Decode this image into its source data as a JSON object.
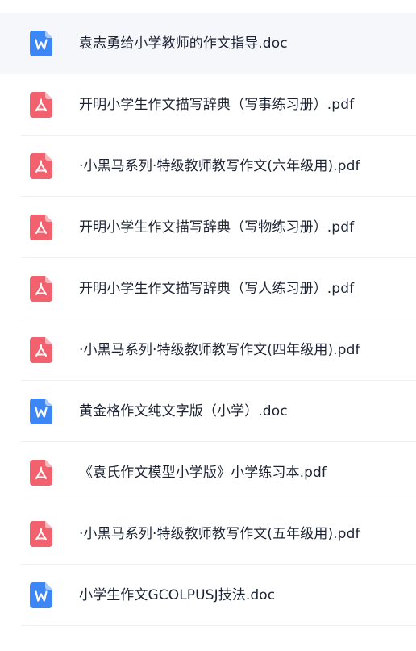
{
  "files": [
    {
      "name": "袁志勇给小学教师的作文指导.doc",
      "type": "doc",
      "icon": "word-doc-icon",
      "selected": true
    },
    {
      "name": "开明小学生作文描写辞典（写事练习册）.pdf",
      "type": "pdf",
      "icon": "pdf-icon",
      "selected": false
    },
    {
      "name": "·小黑马系列·特级教师教写作文(六年级用).pdf",
      "type": "pdf",
      "icon": "pdf-icon",
      "selected": false
    },
    {
      "name": "开明小学生作文描写辞典（写物练习册）.pdf",
      "type": "pdf",
      "icon": "pdf-icon",
      "selected": false
    },
    {
      "name": "开明小学生作文描写辞典（写人练习册）.pdf",
      "type": "pdf",
      "icon": "pdf-icon",
      "selected": false
    },
    {
      "name": "·小黑马系列·特级教师教写作文(四年级用).pdf",
      "type": "pdf",
      "icon": "pdf-icon",
      "selected": false
    },
    {
      "name": "黄金格作文纯文字版（小学）.doc",
      "type": "doc",
      "icon": "word-doc-icon",
      "selected": false
    },
    {
      "name": "《袁氏作文模型小学版》小学练习本.pdf",
      "type": "pdf",
      "icon": "pdf-icon",
      "selected": false
    },
    {
      "name": "·小黑马系列·特级教师教写作文(五年级用).pdf",
      "type": "pdf",
      "icon": "pdf-icon",
      "selected": false
    },
    {
      "name": "小学生作文GCOLPUSJ技法.doc",
      "type": "doc",
      "icon": "word-doc-icon",
      "selected": false
    }
  ],
  "colors": {
    "doc": "#3d86f5",
    "pdf": "#f2616e",
    "selected_background": "#f5f7fb",
    "text": "#1c2333",
    "divider": "#eef0f4"
  }
}
